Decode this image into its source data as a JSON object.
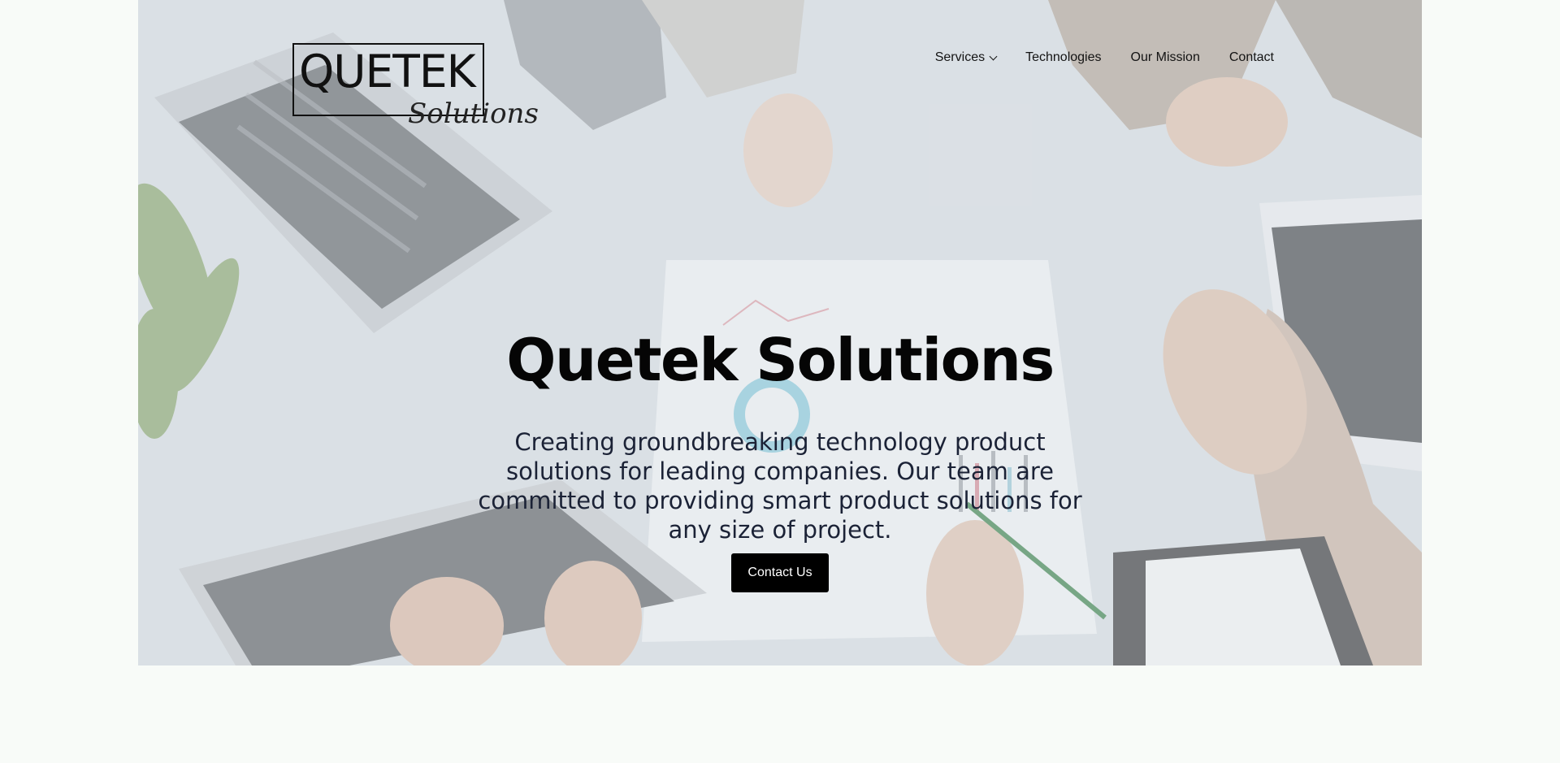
{
  "logo": {
    "main": "QUETEK",
    "sub": "Solutions"
  },
  "nav": {
    "items": [
      {
        "label": "Services",
        "has_dropdown": true
      },
      {
        "label": "Technologies"
      },
      {
        "label": "Our Mission"
      },
      {
        "label": "Contact"
      }
    ]
  },
  "hero": {
    "title": "Quetek Solutions",
    "subtitle": "Creating groundbreaking technology product solutions for leading companies. Our team are committed to providing smart product solutions for any size of project.",
    "cta_label": "Contact Us"
  },
  "colors": {
    "page_background": "#f8fbf8",
    "button_background": "#000000",
    "button_text": "#ffffff",
    "title_text": "#050505",
    "subtitle_text": "#1b2236"
  }
}
